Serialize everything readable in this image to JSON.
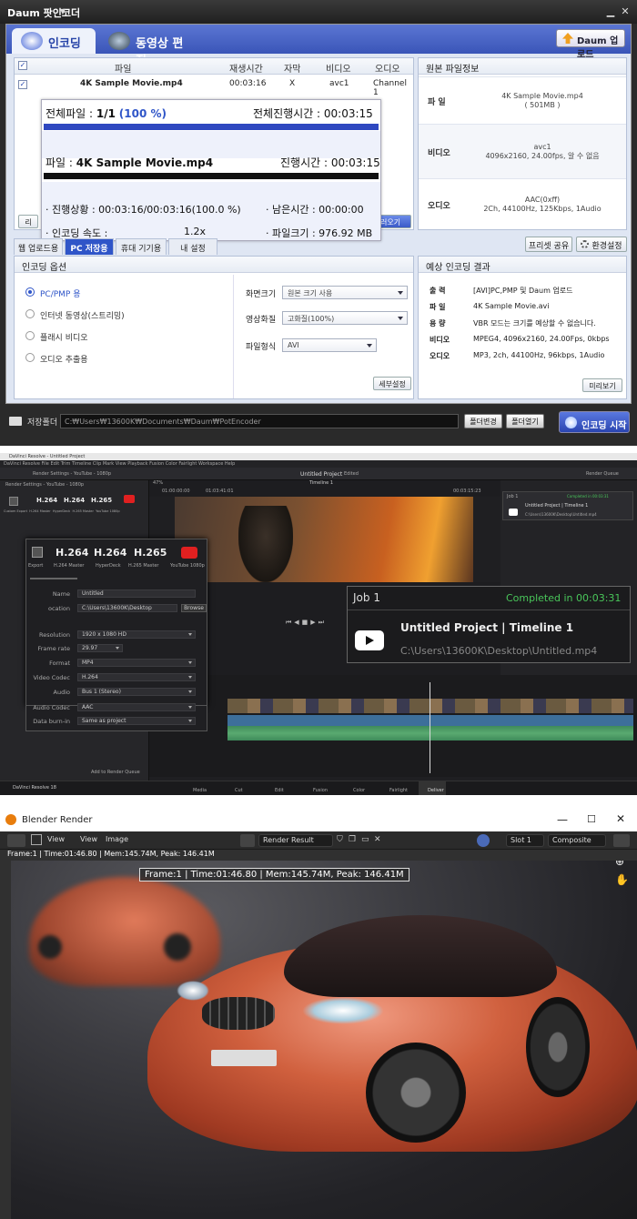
{
  "potencoder": {
    "window_title": "Daum 팟인코더",
    "tabs": {
      "encoding": "인코딩",
      "video_edit": "동영상 편집"
    },
    "daum_upload_btn": "Daum 업로드",
    "file_list": {
      "headers": {
        "file": "파일",
        "duration": "재생시간",
        "subtitle": "자막",
        "video": "비디오",
        "audio": "오디오"
      },
      "rows": [
        {
          "file": "4K Sample Movie.mp4",
          "duration": "00:03:16",
          "subtitle": "X",
          "video": "avc1",
          "audio": "Channel 1"
        }
      ]
    },
    "progress": {
      "total_label": "전체파일 : ",
      "total_count": "1/1",
      "total_percent": "(100 %)",
      "total_elapsed": "전체진행시간 :  00:03:15",
      "file_label": "파일 : ",
      "file_name": "4K Sample Movie.mp4",
      "file_elapsed": "진행시간 : 00:03:15",
      "status": "· 진행상황 : 00:03:16/00:03:16(100.0 %)",
      "remaining": "· 남은시간 : 00:00:00",
      "speed_label": "· 인코딩 속도 :",
      "speed_value": "1.2x",
      "filesize": "· 파일크기 : 976.92 MB",
      "total_fill": 1.0,
      "file_fill": 1.0
    },
    "side_btn_left": "리",
    "side_btn_right": "러오기",
    "source_info": {
      "title": "원본 파일정보",
      "rows": [
        {
          "key": "파  일",
          "value1": "4K Sample Movie.mp4",
          "value2": "( 501MB )"
        },
        {
          "key": "비디오",
          "value1": "avc1",
          "value2": "4096x2160, 24.00fps, 알 수 없음"
        },
        {
          "key": "오디오",
          "value1": "AAC(0xff)",
          "value2": "2Ch, 44100Hz, 125Kbps, 1Audio"
        }
      ]
    },
    "subtabs": [
      "웹 업로드용",
      "PC 저장용",
      "휴대 기기용",
      "내 설정"
    ],
    "preset_share": "프리셋 공유",
    "settings_btn": "환경설정",
    "encode_options": {
      "title": "인코딩 옵션",
      "radios": [
        "PC/PMP 용",
        "인터넷 동영상(스트리밍)",
        "플래시 비디오",
        "오디오 추출용"
      ],
      "screen_size_label": "화면크기",
      "screen_size_value": "원본 크기 사용",
      "quality_label": "영상화질",
      "quality_value": "고화질(100%)",
      "format_label": "파일형식",
      "format_value": "AVI",
      "detail_btn": "세부설정"
    },
    "expected": {
      "title": "예상 인코딩 결과",
      "rows": [
        {
          "key": "출  력",
          "value": "[AVI]PC,PMP 및 Daum 업로드"
        },
        {
          "key": "파  일",
          "value": "4K Sample Movie.avi"
        },
        {
          "key": "용  량",
          "value": "VBR 모드는 크기를 예상할 수 없습니다."
        },
        {
          "key": "비디오",
          "value": "MPEG4, 4096x2160, 24.00Fps, 0kbps"
        },
        {
          "key": "오디오",
          "value": "MP3, 2ch, 44100Hz, 96kbps, 1Audio"
        }
      ],
      "preview_btn": "미리보기"
    },
    "bottom": {
      "save_folder_label": "저장폴더",
      "path": "C:₩Users₩13600K₩Documents₩Daum₩PotEncoder",
      "change_btn": "폴더변경",
      "open_btn": "폴더열기",
      "start_btn": "인코딩 시작"
    }
  },
  "davinci": {
    "window_title": "DaVinci Resolve - Untitled Project",
    "menu": "DaVinci Resolve  File  Edit  Trim  Timeline  Clip  Mark  View  Playback  Fusion  Color  Fairlight  Workspace  Help",
    "project_title": "Untitled Project",
    "project_state": "Edited",
    "render_settings": "Render Settings - YouTube - 1080p",
    "render_queue": "Render Queue",
    "small_formats": [
      "H.264",
      "H.264",
      "H.265"
    ],
    "small_format_subs": [
      "Custom Export",
      "H.264 Master",
      "HyperDeck",
      "H.265 Master",
      "YouTube 1080p"
    ],
    "timeline_name": "Timeline 1",
    "timecode_in": "01:00:00:00",
    "timecode_out": "01:03:41:01",
    "timecode_dur": "00:03:15:23",
    "zoom": "47%",
    "dialog": {
      "formats": [
        "H.264",
        "H.264",
        "H.265"
      ],
      "subs": [
        "Export",
        "H.264 Master",
        "HyperDeck",
        "H.265 Master",
        "YouTube 1080p"
      ],
      "name_label": "Name",
      "name_value": "Untitled",
      "location_label": "ocation",
      "location_value": "C:\\Users\\13600K\\Desktop",
      "browse": "Browse",
      "fields": [
        {
          "label": "Resolution",
          "value": "1920 x 1080 HD"
        },
        {
          "label": "Frame rate",
          "value": "29.97"
        },
        {
          "label": "Format",
          "value": "MP4"
        },
        {
          "label": "Video Codec",
          "value": "H.264"
        },
        {
          "label": "Audio",
          "value": "Bus 1 (Stereo)"
        },
        {
          "label": "Audio Codec",
          "value": "AAC"
        },
        {
          "label": "Data burn-in",
          "value": "Same as project"
        }
      ],
      "add_to_queue": "Add to Render Queue"
    },
    "job": {
      "title": "Job 1",
      "status": "Completed in 00:03:31",
      "name": "Untitled Project | Timeline 1",
      "path": "C:\\Users\\13600K\\Desktop\\Untitled.mp4"
    },
    "pages": [
      "Media",
      "Cut",
      "Edit",
      "Fusion",
      "Color",
      "Fairlight",
      "Deliver"
    ],
    "brand": "DaVinci Resolve 18",
    "accent": "#49c65a"
  },
  "blender": {
    "window_title": "Blender Render",
    "menus": [
      "View",
      "View",
      "Image"
    ],
    "render_result": "Render Result",
    "slot": "Slot 1",
    "pass": "Composite",
    "stats": "Frame:1 | Time:01:46.80 | Mem:145.74M, Peak: 146.41M",
    "overlay_stats": "Frame:1 | Time:01:46.80 | Mem:145.74M, Peak: 146.41M"
  }
}
